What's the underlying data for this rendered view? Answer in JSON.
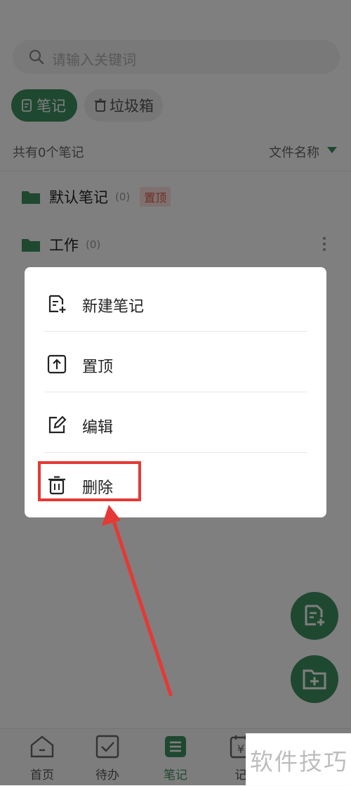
{
  "search": {
    "placeholder": "请输入关键词",
    "icon": "search-icon"
  },
  "filters": {
    "notes_label": "笔记",
    "trash_label": "垃圾箱"
  },
  "summary": {
    "count_text": "共有0个笔记",
    "sort_label": "文件名称"
  },
  "folders": [
    {
      "name": "默认笔记",
      "count": "(0)",
      "badge": "置顶"
    },
    {
      "name": "工作",
      "count": "(0)"
    }
  ],
  "context_menu": {
    "items": [
      {
        "label": "新建笔记",
        "icon": "new-note-icon"
      },
      {
        "label": "置顶",
        "icon": "pin-top-icon"
      },
      {
        "label": "编辑",
        "icon": "edit-icon"
      },
      {
        "label": "删除",
        "icon": "trash-icon"
      }
    ]
  },
  "tabbar": {
    "tabs": [
      {
        "label": "首页",
        "icon": "home-icon"
      },
      {
        "label": "待办",
        "icon": "checkbox-icon"
      },
      {
        "label": "笔记",
        "icon": "notes-icon",
        "active": true
      },
      {
        "label": "记",
        "icon": "ledger-icon"
      }
    ]
  },
  "watermark": {
    "text": "软件技巧"
  },
  "colors": {
    "accent": "#3f9060",
    "highlight": "#e53935",
    "badge_bg": "#fde2df",
    "badge_text": "#e05a4e"
  }
}
